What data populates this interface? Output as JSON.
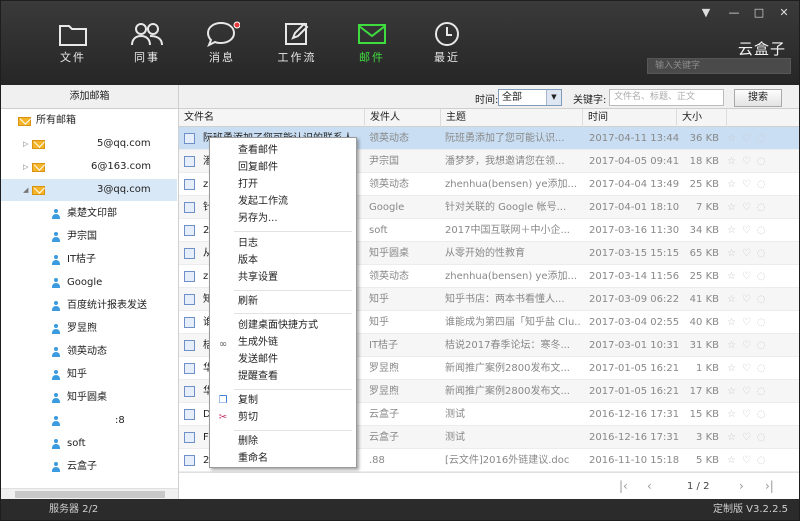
{
  "nav": [
    {
      "label": "文件",
      "icon": "folder-icon"
    },
    {
      "label": "同事",
      "icon": "colleagues-icon"
    },
    {
      "label": "消息",
      "icon": "message-icon"
    },
    {
      "label": "工作流",
      "icon": "edit-icon"
    },
    {
      "label": "邮件",
      "icon": "mail-icon",
      "active": true
    },
    {
      "label": "最近",
      "icon": "clock-icon"
    }
  ],
  "brand": "云盒子",
  "top_search_placeholder": "输入关键字",
  "window_controls": [
    "▼",
    "—",
    "□",
    "✕"
  ],
  "toolbar": {
    "add_mailbox": "添加邮箱",
    "time_label": "时间:",
    "time_value": "全部",
    "keyword_label": "关键字:",
    "keyword_placeholder": "文件名、标题、正文",
    "search_button": "搜索"
  },
  "sidebar": {
    "root": "所有邮箱",
    "accounts": [
      "5@qq.com",
      "6@163.com",
      "3@qq.com"
    ],
    "folders": [
      "桌楚文印部",
      "尹宗国",
      "IT桔子",
      "Google",
      "百度统计报表发送",
      "罗昱煦",
      "领英动态",
      "知乎",
      "知乎圆桌",
      ":8",
      "soft",
      "云盒子"
    ]
  },
  "columns": [
    "文件名",
    "发件人",
    "主题",
    "时间",
    "大小"
  ],
  "rows": [
    {
      "name": "阮班勇添加了您可能认识的联系人",
      "sender": "领英动态",
      "subject": "阮班勇添加了您可能认识...",
      "time": "2017-04-11 13:44",
      "size": "36 KB"
    },
    {
      "name": "潘",
      "sender": "尹宗国",
      "subject": "潘梦梦，我想邀请您在领...",
      "time": "2017-04-05 09:41",
      "size": "18 KB"
    },
    {
      "name": "zh",
      "sender": "领英动态",
      "subject": "zhenhua(bensen) ye添加...",
      "time": "2017-04-04 13:49",
      "size": "25 KB"
    },
    {
      "name": "针",
      "sender": "Google",
      "subject": "针对关联的 Google 帐号...",
      "time": "2017-04-01 18:10",
      "size": "7 KB"
    },
    {
      "name": "20",
      "sender": "soft",
      "subject": "2017中国互联网＋中小企...",
      "time": "2017-03-16 11:30",
      "size": "34 KB"
    },
    {
      "name": "从",
      "sender": "知乎圆桌",
      "subject": "从零开始的性教育",
      "time": "2017-03-15 15:15",
      "size": "65 KB"
    },
    {
      "name": "zh",
      "sender": "领英动态",
      "subject": "zhenhua(bensen) ye添加...",
      "time": "2017-03-14 11:56",
      "size": "25 KB"
    },
    {
      "name": "知",
      "sender": "知乎",
      "subject": "知乎书店：两本书看懂人...",
      "time": "2017-03-09 06:22",
      "size": "41 KB"
    },
    {
      "name": "谁",
      "sender": "知乎",
      "subject": "谁能成为第四届「知乎盐 Clu...",
      "time": "2017-03-04 02:55",
      "size": "40 KB"
    },
    {
      "name": "桔",
      "sender": "IT桔子",
      "subject": "桔说2017春季论坛：寒冬...",
      "time": "2017-03-01 10:31",
      "size": "31 KB"
    },
    {
      "name": "华",
      "sender": "罗昱煦",
      "subject": "新闻推广案例2800发布文...",
      "time": "2017-01-05 16:21",
      "size": "1 KB"
    },
    {
      "name": "华",
      "sender": "罗昱煦",
      "subject": "新闻推广案例2800发布文...",
      "time": "2017-01-05 16:21",
      "size": "17 KB"
    },
    {
      "name": "D",
      "sender": "云盒子",
      "subject": "测试",
      "time": "2016-12-16 17:31",
      "size": "15 KB"
    },
    {
      "name": "F",
      "sender": "云盒子",
      "subject": "测试",
      "time": "2016-12-16 17:31",
      "size": "3 KB"
    },
    {
      "name": "2",
      "sender": ".88",
      "subject": "[云文件]2016外链建议.doc",
      "time": "2016-11-10 15:18",
      "size": "5 KB"
    }
  ],
  "context_menu": {
    "group1": [
      "查看邮件",
      "回复邮件",
      "打开",
      "发起工作流",
      "另存为..."
    ],
    "group2": [
      "日志",
      "版本",
      "共享设置"
    ],
    "group3": [
      "刷新"
    ],
    "group4": [
      "创建桌面快捷方式",
      "生成外链",
      "发送邮件",
      "提醒查看"
    ],
    "group5": [
      "复制",
      "剪切"
    ],
    "group6": [
      "删除",
      "重命名"
    ]
  },
  "pager": {
    "page": "1 / 2"
  },
  "status": {
    "server": "服务器 2/2",
    "version": "定制版 V3.2.2.5"
  },
  "colors": {
    "active_nav": "#3fdc3f",
    "selection": "#c9def3",
    "topbar": "#2f2f2f"
  }
}
